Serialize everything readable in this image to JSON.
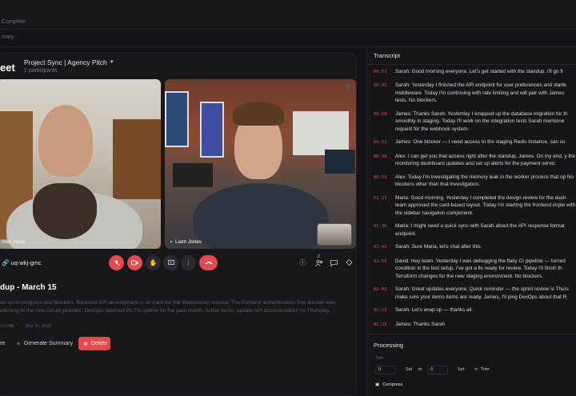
{
  "topbar": {
    "crumb": "Complete"
  },
  "subbar": {
    "crumb": "mary"
  },
  "meeting": {
    "app_title": "eet",
    "project_name": "Project Sync | Agency Pitch",
    "participants": "2 participants",
    "code": "uq-wkj-gmc",
    "title": "dup - March 15",
    "description": "ed sprint progress and blockers. Backend API development is on track for the Wednesday release. The frontend authentication flow blocker was witching to the new OAuth provider. DevOps reported 99.7% uptime for the past month. Action items: update API documentation by Thursday,",
    "meta_size": "0.0 MB",
    "meta_date": "Mar 15, 2025",
    "tiles": [
      {
        "name": "cker (You)"
      },
      {
        "name": "Liam Jones"
      }
    ],
    "participant_badge": "2"
  },
  "actions": {
    "share_label": "re",
    "generate_label": "Generate Summary",
    "delete_label": "Delete"
  },
  "transcript": {
    "title": "Transcript",
    "lines": [
      {
        "time": "00:01",
        "text": "Sarah: Good morning everyone. Let's get started with the standup. I'll go fi"
      },
      {
        "time": "00:05",
        "text": "Sarah: Yesterday I finished the API endpoint for user preferences and starte middleware. Today I'm continuing with rate limiting and will pair with James tests. No blockers."
      },
      {
        "time": "00:18",
        "text": "James: Thanks Sarah. Yesterday I wrapped up the database migration for th smoothly in staging. Today I'll work on the integration tests Sarah mentione request for the webhook system."
      },
      {
        "time": "00:31",
        "text": "James: One blocker — I need access to the staging Redis instance, can so"
      },
      {
        "time": "00:38",
        "text": "Alex: I can get you that access right after the standup, James. On my end, y the monitoring dashboard updates and set up alerts for the payment servic"
      },
      {
        "time": "00:50",
        "text": "Alex: Today I'm investigating the memory leak in the worker process that op No blockers other than that investigation."
      },
      {
        "time": "01:21",
        "text": "Maria: Good morning. Yesterday I completed the design review for the dash team approved the card-based layout. Today I'm starting the frontend imple with the sidebar navigation component."
      },
      {
        "time": "01:36",
        "text": "Maria: I might need a quick sync with Sarah about the API response format endpoint."
      },
      {
        "time": "01:45",
        "text": "Sarah: Sure Maria, let's chat after this."
      },
      {
        "time": "01:50",
        "text": "David: Hey team. Yesterday I was debugging the flaky CI pipeline — turned condition in the test setup. I've got a fix ready for review. Today I'll finish th Terraform changes for the new staging environment. No blockers."
      },
      {
        "time": "02:08",
        "text": "Sarah: Great updates everyone. Quick reminder — the sprint review is Thurs make sure your demo items are ready. James, I'll ping DevOps about that R"
      },
      {
        "time": "02:23",
        "text": "Sarah: Let's wrap up — thanks all."
      },
      {
        "time": "02:25",
        "text": "James: Thanks Sarah"
      }
    ]
  },
  "processing": {
    "title": "Processing",
    "trim_label": "Trim",
    "start_value": "0",
    "set_label": "Set",
    "to_label": "to",
    "end_value": "0",
    "set_label_2": "Set",
    "trim_button": "Trim",
    "compress_label": "Compress"
  },
  "colors": {
    "accent_red": "#e5484d",
    "background": "#131315",
    "panel": "#18181b"
  }
}
